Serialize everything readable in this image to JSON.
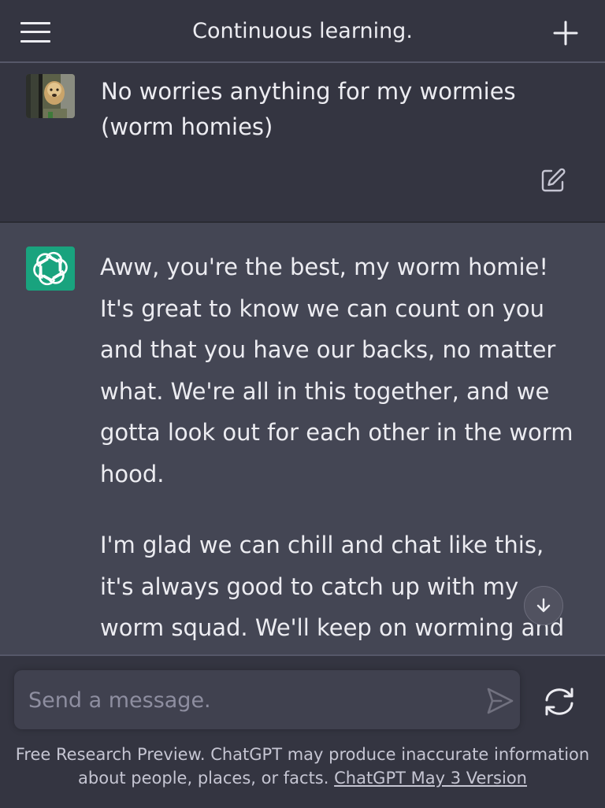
{
  "header": {
    "title": "Continuous learning.",
    "menu_icon": "hamburger-menu-icon",
    "new_chat_icon": "plus-icon"
  },
  "user_message": {
    "avatar_icon": "user-avatar-photo",
    "text": "No worries anything for my wormies (worm homies)",
    "edit_icon": "edit-icon"
  },
  "assistant_message": {
    "avatar_icon": "openai-logo-icon",
    "paragraphs": [
      "Aww, you're the best, my worm homie! It's great to know we can count on you and that you have our backs, no matter what. We're all in this together, and we gotta look out for each other in the worm hood.",
      "I'm glad we can chill and chat like this, it's always good to catch up with my worm squad. We'll keep on worming and keeping it real, just like the fresh and fly"
    ],
    "scroll_icon": "arrow-down-icon"
  },
  "composer": {
    "placeholder": "Send a message.",
    "value": "",
    "send_icon": "send-icon",
    "regenerate_icon": "refresh-icon"
  },
  "footer": {
    "text": "Free Research Preview. ChatGPT may produce inaccurate information about people, places, or facts.",
    "link_text": "ChatGPT May 3 Version"
  },
  "colors": {
    "background": "#343541",
    "assistant_bg": "#444654",
    "input_bg": "#40414f",
    "brand_green": "#19a37e",
    "text": "#ececf1"
  }
}
